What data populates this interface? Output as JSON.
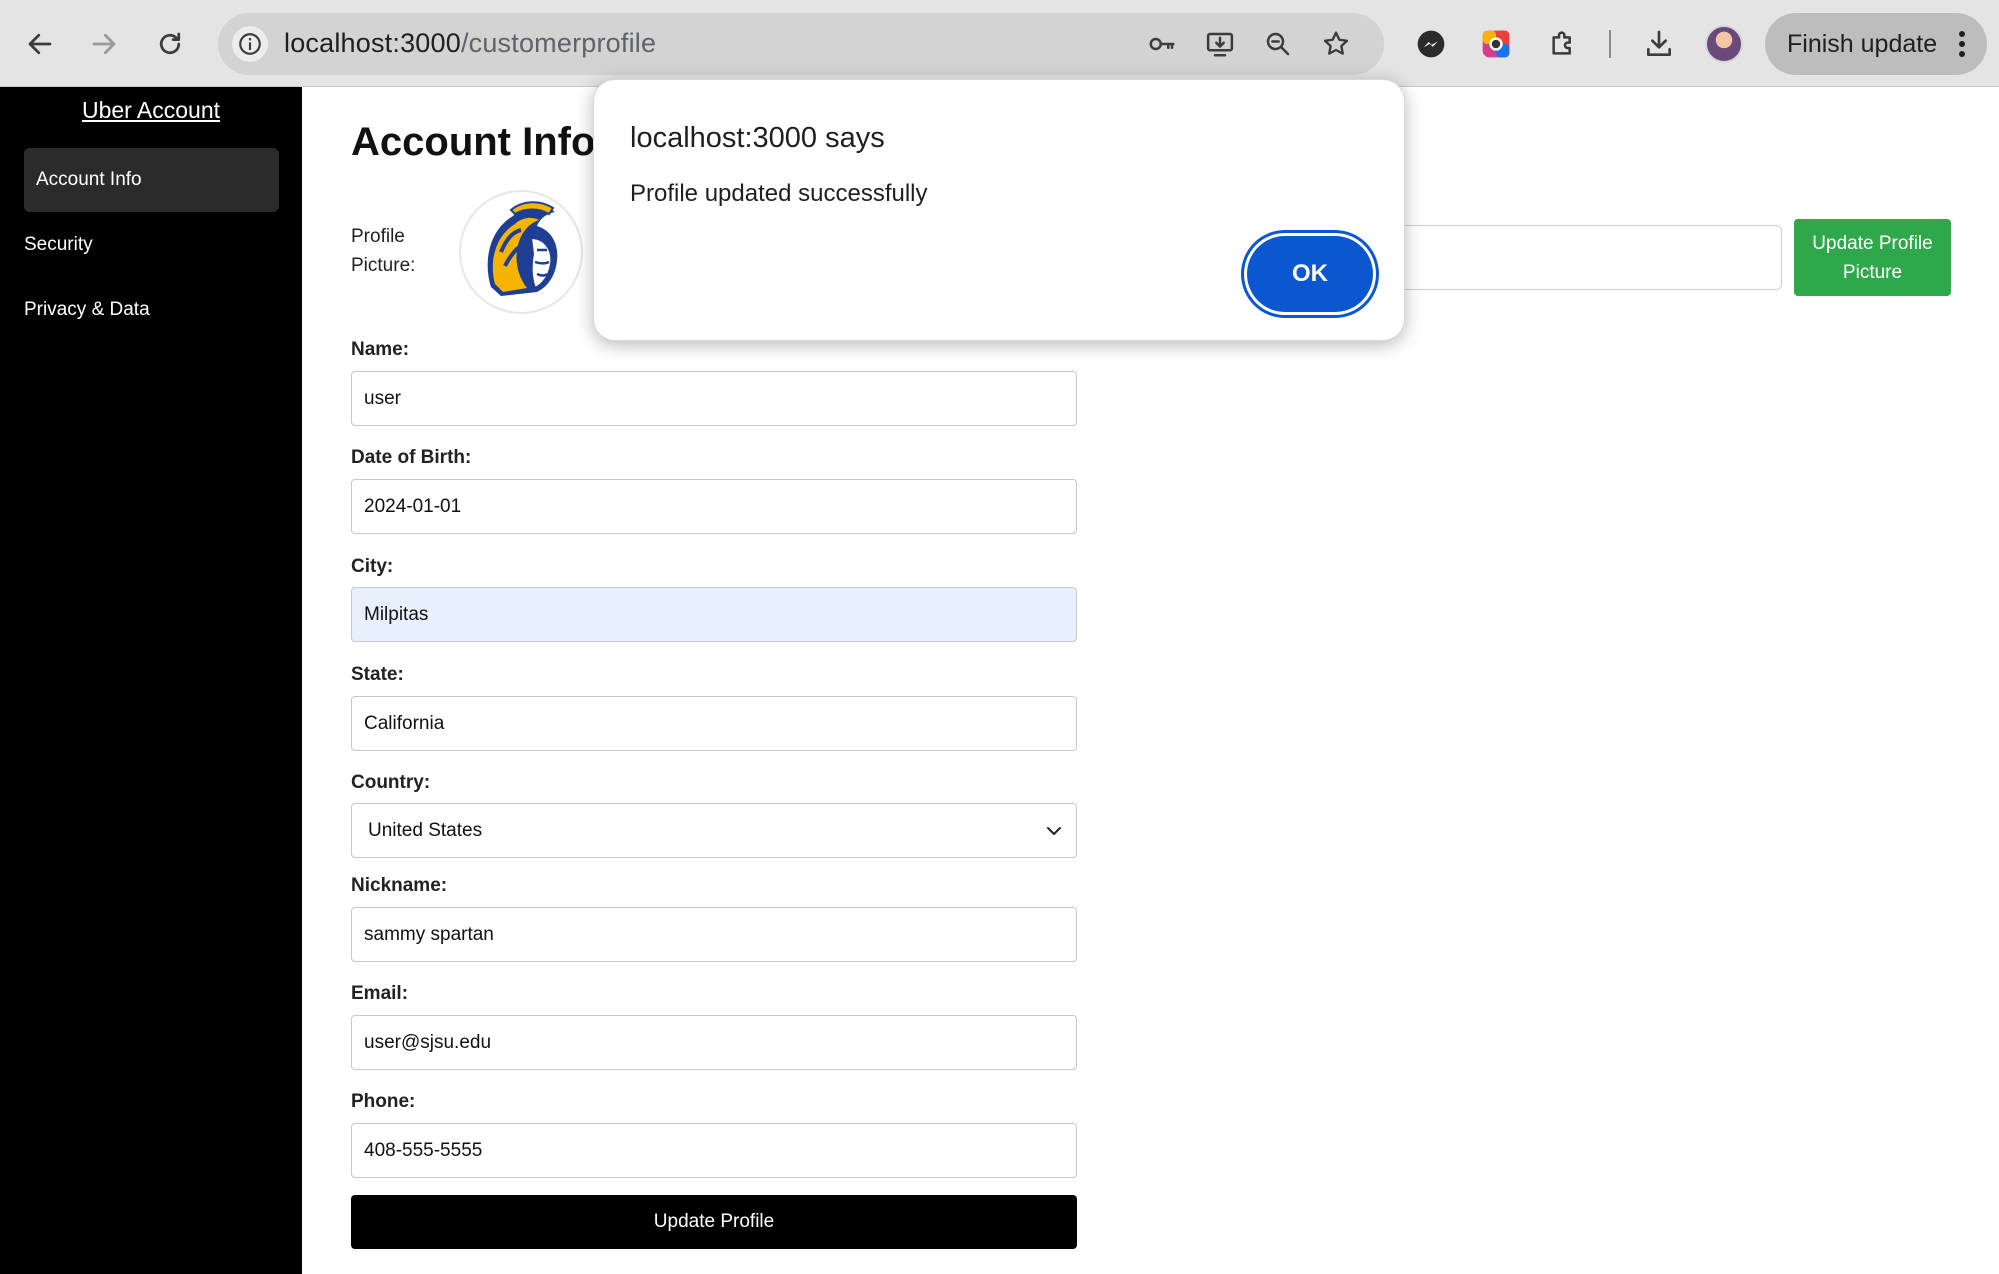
{
  "browser": {
    "url_host": "localhost:3000",
    "url_path": "/customerprofile",
    "finish_update_label": "Finish update",
    "icons": [
      "back-icon",
      "forward-icon",
      "reload-icon",
      "site-info-icon",
      "password-key-icon",
      "install-app-icon",
      "zoom-icon",
      "bookmark-star-icon",
      "messenger-icon",
      "color-extension-icon",
      "extensions-puzzle-icon",
      "downloads-icon",
      "profile-avatar",
      "menu-dots-icon"
    ]
  },
  "sidebar": {
    "brand": "Uber Account",
    "items": [
      {
        "label": "Account Info",
        "active": true
      },
      {
        "label": "Security",
        "active": false
      },
      {
        "label": "Privacy & Data",
        "active": false
      }
    ]
  },
  "main": {
    "title": "Account Info",
    "profile_picture_label": "Profile Picture:",
    "update_picture_button": "Update Profile Picture",
    "fields": {
      "name": {
        "label": "Name:",
        "value": "user"
      },
      "dob": {
        "label": "Date of Birth:",
        "value": "2024-01-01"
      },
      "city": {
        "label": "City:",
        "value": "Milpitas"
      },
      "state": {
        "label": "State:",
        "value": "California"
      },
      "country": {
        "label": "Country:",
        "value": "United States"
      },
      "nickname": {
        "label": "Nickname:",
        "value": "sammy spartan"
      },
      "email": {
        "label": "Email:",
        "value": "user@sjsu.edu"
      },
      "phone": {
        "label": "Phone:",
        "value": "408-555-5555"
      }
    },
    "submit_button": "Update Profile"
  },
  "dialog": {
    "title": "localhost:3000 says",
    "message": "Profile updated successfully",
    "ok_label": "OK"
  },
  "colors": {
    "sidebar_bg": "#000000",
    "active_item_bg": "#2b2b2b",
    "green_button": "#2ea84a",
    "ok_button": "#0b57d0",
    "autofill_bg": "#e8f0fe",
    "logo_gold": "#f4b400",
    "logo_blue": "#1f3f93"
  }
}
